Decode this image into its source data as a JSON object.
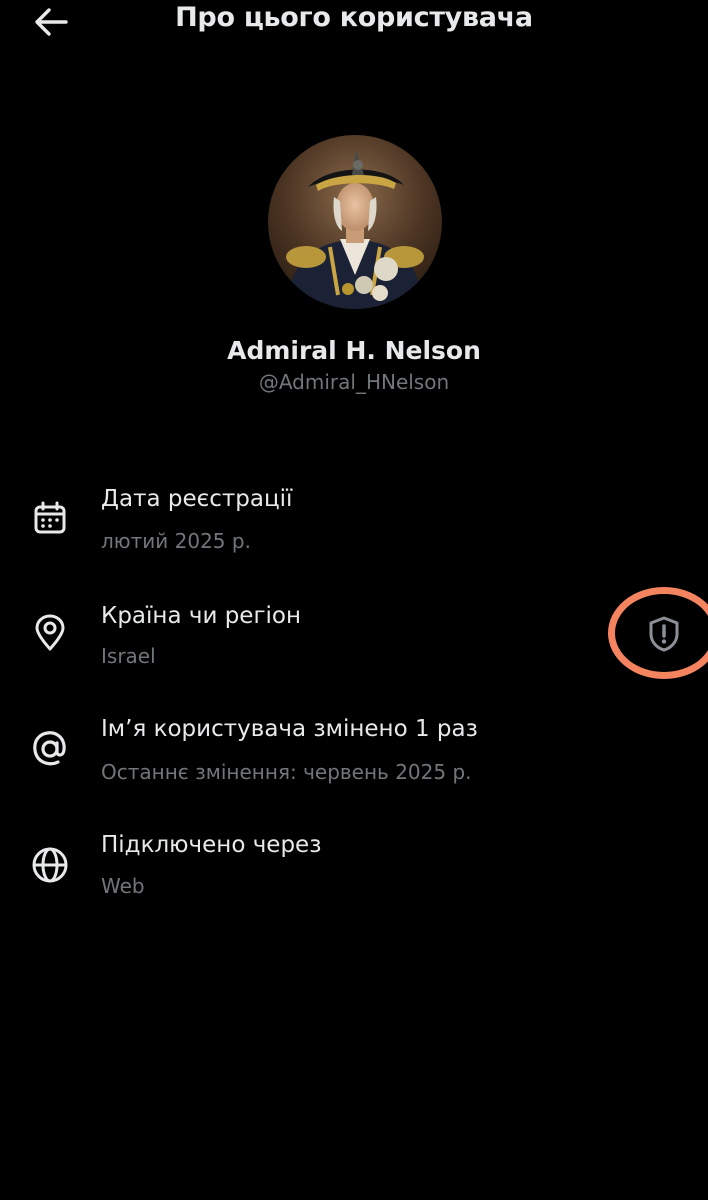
{
  "header": {
    "title": "Про цього користувача",
    "back_icon": "arrow-left-icon"
  },
  "profile": {
    "display_name": "Admiral H. Nelson",
    "handle": "@Admiral_HNelson",
    "avatar_description": "portrait-avatar"
  },
  "info": [
    {
      "icon": "calendar-icon",
      "label": "Дата реєстрації",
      "value": "лютий 2025 р."
    },
    {
      "icon": "location-pin-icon",
      "label": "Країна чи регіон",
      "value": "Israel",
      "badge_icon": "shield-alert-icon"
    },
    {
      "icon": "at-sign-icon",
      "label": "Ім’я користувача змінено 1 раз",
      "value": "Останнє змінення: червень 2025 р."
    },
    {
      "icon": "globe-icon",
      "label": "Підключено через",
      "value": "Web"
    }
  ],
  "colors": {
    "background": "#000000",
    "primary_text": "#e7e9ea",
    "secondary_text": "#71767b",
    "highlight": "#f4845f"
  }
}
